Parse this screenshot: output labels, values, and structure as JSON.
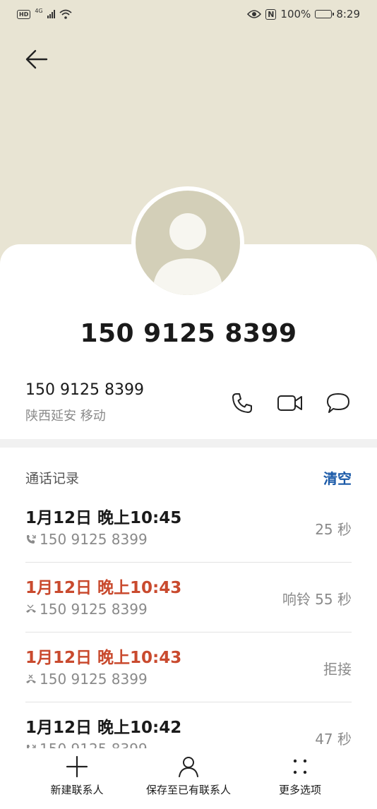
{
  "status_bar": {
    "hd": "HD",
    "network": "4G",
    "nfc": "N",
    "battery_pct": "100%",
    "time": "8:29"
  },
  "contact": {
    "display_number": "150 9125 8399",
    "number": "150 9125 8399",
    "location": "陕西延安 移动"
  },
  "call_log": {
    "title": "通话记录",
    "clear_label": "清空",
    "items": [
      {
        "date": "1月12日 晚上10:45",
        "number": "150 9125 8399",
        "right": "25 秒",
        "type": "outgoing"
      },
      {
        "date": "1月12日 晚上10:43",
        "number": "150 9125 8399",
        "right": "响铃 55 秒",
        "type": "missed"
      },
      {
        "date": "1月12日 晚上10:43",
        "number": "150 9125 8399",
        "right": "拒接",
        "type": "rejected"
      },
      {
        "date": "1月12日 晚上10:42",
        "number": "150 9125 8399",
        "right": "47 秒",
        "type": "outgoing"
      }
    ]
  },
  "bottom_bar": {
    "new_contact": "新建联系人",
    "save_existing": "保存至已有联系人",
    "more_options": "更多选项"
  },
  "colors": {
    "header_bg": "#e8e4d3",
    "missed": "#c94a2e",
    "accent": "#1b5aa8"
  }
}
